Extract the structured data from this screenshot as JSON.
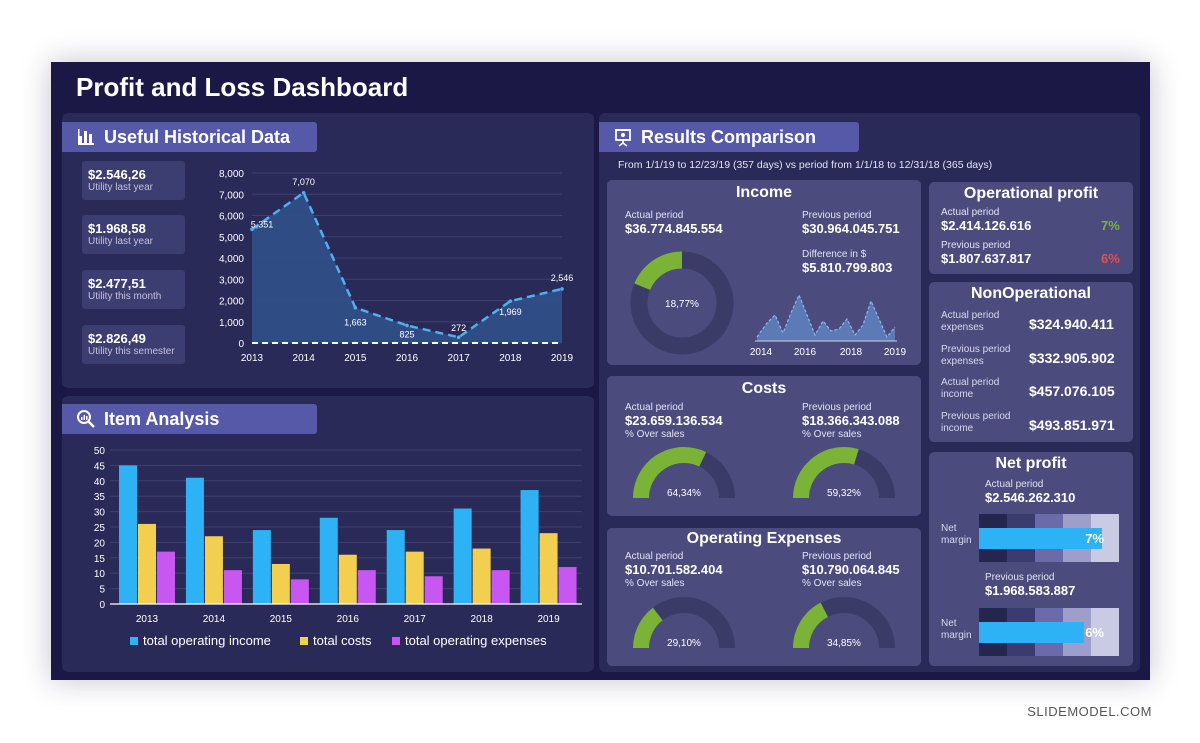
{
  "title": "Profit and Loss Dashboard",
  "footer": "SLIDEMODEL.COM",
  "colors": {
    "background": "#1b1845",
    "panel": "#292a57",
    "card": "#4b4c7d",
    "header": "#5658a8",
    "green": "#7ab335",
    "red": "#e0524c",
    "blue": "#2db3f5",
    "yellow": "#f2cf4e",
    "purple": "#c856f0"
  },
  "historical": {
    "header": "Useful Historical Data",
    "icon": "bar-chart-icon",
    "kpis": [
      {
        "value": "$2.546,26",
        "label": "Utility last year"
      },
      {
        "value": "$1.968,58",
        "label": "Utility last year"
      },
      {
        "value": "$2.477,51",
        "label": "Utility this month"
      },
      {
        "value": "$2.826,49",
        "label": "Utility this semester"
      }
    ]
  },
  "item_analysis": {
    "header": "Item Analysis",
    "icon": "magnifier-chart-icon"
  },
  "results": {
    "header": "Results Comparison",
    "icon": "presentation-icon",
    "period_text": "From 1/1/19 to 12/23/19 (357 days) vs period from  1/1/18 to 12/31/18 (365 days)",
    "income": {
      "title": "Income",
      "actual_label": "Actual period",
      "actual_value": "$36.774.845.554",
      "previous_label": "Previous period",
      "previous_value": "$30.964.045.751",
      "difference_label": "Difference in $",
      "difference_value": "$5.810.799.803",
      "donut_label": "18,77%",
      "donut_pct": 18.77,
      "spark_ticks": [
        "2014",
        "2016",
        "2018",
        "2019"
      ]
    },
    "costs": {
      "title": "Costs",
      "actual_label": "Actual period",
      "actual_value": "$23.659.136.534",
      "actual_sub": "% Over sales",
      "previous_label": "Previous period",
      "previous_value": "$18.366.343.088",
      "previous_sub": "% Over sales",
      "gauge1_label": "64,34%",
      "gauge1_pct": 64.34,
      "gauge2_label": "59,32%",
      "gauge2_pct": 59.32
    },
    "opex": {
      "title": "Operating Expenses",
      "actual_label": "Actual period",
      "actual_value": "$10.701.582.404",
      "actual_sub": "% Over sales",
      "previous_label": "Previous period",
      "previous_value": "$10.790.064.845",
      "previous_sub": "% Over sales",
      "gauge1_label": "29,10%",
      "gauge1_pct": 29.1,
      "gauge2_label": "34,85%",
      "gauge2_pct": 34.85
    },
    "operational_profit": {
      "title": "Operational profit",
      "actual_label": "Actual period",
      "actual_value": "$2.414.126.616",
      "actual_pct": "7%",
      "previous_label": "Previous period",
      "previous_value": "$1.807.637.817",
      "previous_pct": "6%"
    },
    "nonoperational": {
      "title": "NonOperational",
      "rows": [
        {
          "label": "Actual period expenses",
          "value": "$324.940.411"
        },
        {
          "label": "Previous period expenses",
          "value": "$332.905.902"
        },
        {
          "label": "Actual period income",
          "value": "$457.076.105"
        },
        {
          "label": "Previous period income",
          "value": "$493.851.971"
        }
      ]
    },
    "net_profit": {
      "title": "Net profit",
      "actual_label": "Actual period",
      "actual_value": "$2.546.262.310",
      "previous_label": "Previous period",
      "previous_value": "$1.968.583.887",
      "margin_label": "Net margin",
      "actual_margin": "7%",
      "actual_margin_pct": 7,
      "previous_margin": "6%",
      "previous_margin_pct": 6
    }
  },
  "chart_data": [
    {
      "type": "area",
      "x": [
        "2013",
        "2014",
        "2015",
        "2016",
        "2017",
        "2018",
        "2019"
      ],
      "values": [
        5351,
        7070,
        1663,
        825,
        272,
        1969,
        2546
      ],
      "data_labels": [
        "5,351",
        "7,070",
        "1,663",
        "825",
        "272",
        "1,969",
        "2,546"
      ],
      "ylim": [
        0,
        8000
      ],
      "yticks": [
        "0",
        "1,000",
        "2,000",
        "3,000",
        "4,000",
        "5,000",
        "6,000",
        "7,000",
        "8,000"
      ],
      "grid": true
    },
    {
      "type": "bar",
      "categories": [
        "2013",
        "2014",
        "2015",
        "2016",
        "2017",
        "2018",
        "2019"
      ],
      "series": [
        {
          "name": "total operating income",
          "color": "#2db3f5",
          "values": [
            45,
            41,
            24,
            28,
            24,
            31,
            37
          ]
        },
        {
          "name": "total costs",
          "color": "#f2cf4e",
          "values": [
            26,
            22,
            13,
            16,
            17,
            18,
            23
          ]
        },
        {
          "name": "total operating expenses",
          "color": "#c856f0",
          "values": [
            17,
            11,
            8,
            11,
            9,
            11,
            12
          ]
        }
      ],
      "ylim": [
        0,
        50
      ],
      "yticks": [
        "0",
        "5",
        "10",
        "15",
        "20",
        "25",
        "30",
        "35",
        "40",
        "45",
        "50"
      ],
      "legend": "bottom",
      "grid": true
    }
  ]
}
